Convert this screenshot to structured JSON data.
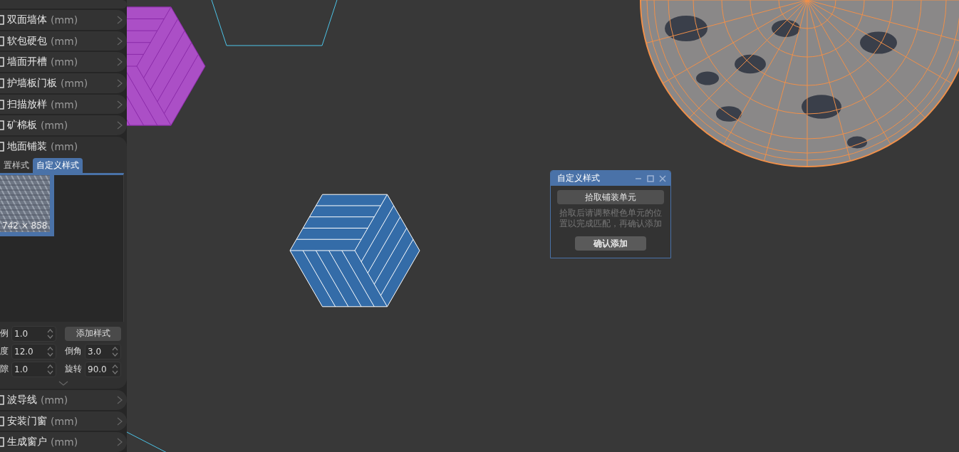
{
  "sidebar": {
    "sections": [
      {
        "label": "双面墙体",
        "unit": "(mm)",
        "expanded": false
      },
      {
        "label": "软包硬包",
        "unit": "(mm)",
        "expanded": false
      },
      {
        "label": "墙面开槽",
        "unit": "(mm)",
        "expanded": false
      },
      {
        "label": "护墙板门板",
        "unit": "(mm)",
        "expanded": false
      },
      {
        "label": "扫描放样",
        "unit": "(mm)",
        "expanded": false
      },
      {
        "label": "矿棉板",
        "unit": "(mm)",
        "expanded": false
      },
      {
        "label": "地面铺装",
        "unit": "(mm)",
        "expanded": true,
        "tabs": [
          {
            "label": "置样式",
            "selected": false
          },
          {
            "label": "自定义样式",
            "selected": true
          }
        ],
        "styles": [
          {
            "caption": "742 × 858",
            "selected": true
          }
        ],
        "params": [
          {
            "kind": "spinner",
            "label": "例",
            "value": "1.0"
          },
          {
            "kind": "button",
            "label": "添加样式"
          },
          {
            "kind": "spinner",
            "label": "度",
            "value": "12.0"
          },
          {
            "kind": "spinner",
            "label": "倒角",
            "value": "3.0"
          },
          {
            "kind": "spinner",
            "label": "隙",
            "value": "1.0"
          },
          {
            "kind": "spinner",
            "label": "旋转",
            "value": "90.0"
          }
        ]
      },
      {
        "label": "波导线",
        "unit": "(mm)",
        "expanded": false
      },
      {
        "label": "安装门窗",
        "unit": "(mm)",
        "expanded": false
      },
      {
        "label": "生成窗户",
        "unit": "(mm)",
        "expanded": false
      }
    ]
  },
  "dialog": {
    "title": "自定义样式",
    "pick_button": "拾取铺装单元",
    "hint": "拾取后请调整橙色单元的位置以完成匹配，再确认添加",
    "confirm_button": "确认添加"
  }
}
